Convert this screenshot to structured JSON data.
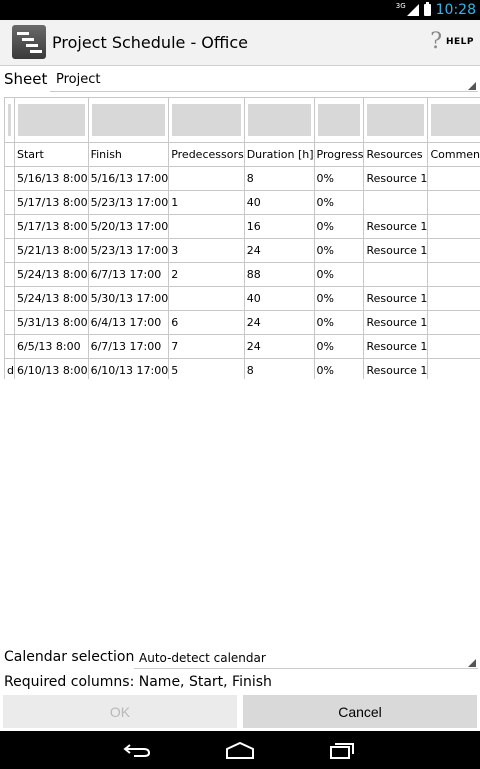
{
  "status": {
    "network": "3G",
    "time": "10:28"
  },
  "app": {
    "title": "Project Schedule - Office",
    "help_label": "HELP"
  },
  "sheet": {
    "label": "Sheet",
    "value": "Project"
  },
  "table": {
    "headers": [
      "",
      "Start",
      "Finish",
      "Predecessors",
      "Duration [h]",
      "Progress",
      "Resources",
      "Comment"
    ],
    "rows": [
      [
        "",
        "5/16/13 8:00",
        "5/16/13 17:00",
        "",
        "8",
        "0%",
        "Resource 1",
        ""
      ],
      [
        "",
        "5/17/13 8:00",
        "5/23/13 17:00",
        "1",
        "40",
        "0%",
        "",
        ""
      ],
      [
        "",
        "5/17/13 8:00",
        "5/20/13 17:00",
        "",
        "16",
        "0%",
        "Resource 1",
        ""
      ],
      [
        "",
        "5/21/13 8:00",
        "5/23/13 17:00",
        "3",
        "24",
        "0%",
        "Resource 1",
        ""
      ],
      [
        "",
        "5/24/13 8:00",
        "6/7/13 17:00",
        "2",
        "88",
        "0%",
        "",
        ""
      ],
      [
        "",
        "5/24/13 8:00",
        "5/30/13 17:00",
        "",
        "40",
        "0%",
        "Resource 1",
        ""
      ],
      [
        "",
        "5/31/13 8:00",
        "6/4/13 17:00",
        "6",
        "24",
        "0%",
        "Resource 1",
        ""
      ],
      [
        "",
        "6/5/13 8:00",
        "6/7/13 17:00",
        "7",
        "24",
        "0%",
        "Resource 1",
        ""
      ],
      [
        "d",
        "6/10/13 8:00",
        "6/10/13 17:00",
        "5",
        "8",
        "0%",
        "Resource 1",
        ""
      ]
    ]
  },
  "calendar": {
    "label": "Calendar selection",
    "value": "Auto-detect calendar"
  },
  "required_text": "Required columns: Name, Start, Finish",
  "buttons": {
    "ok": "OK",
    "cancel": "Cancel"
  },
  "colors": {
    "accent": "#33b5e5",
    "button_bg": "#d9d9d9",
    "disabled_text": "#b8b8b8"
  }
}
